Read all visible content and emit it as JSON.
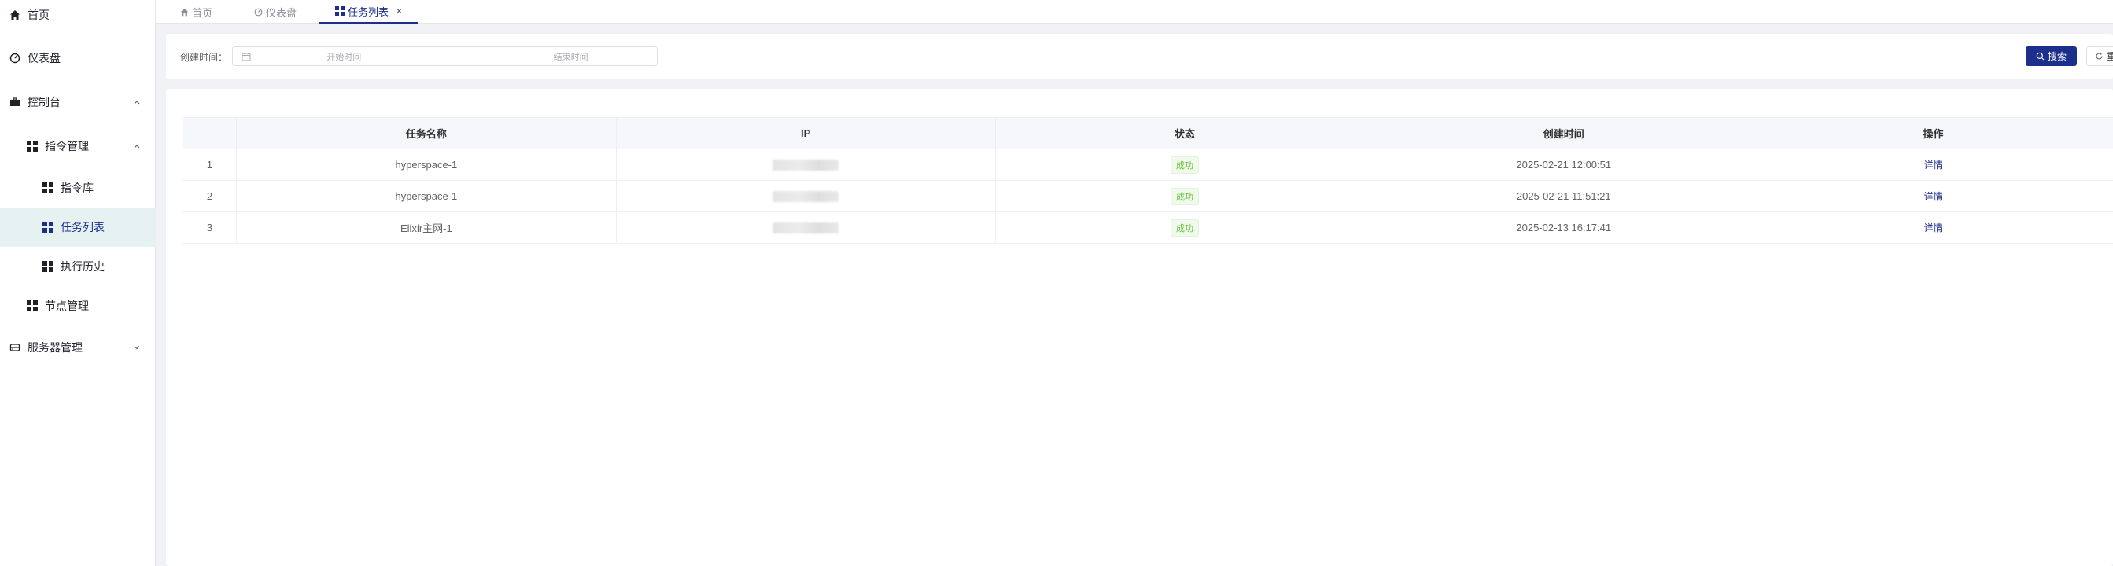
{
  "sidebar": {
    "items": [
      {
        "label": "首页",
        "icon": "home-icon"
      },
      {
        "label": "仪表盘",
        "icon": "dashboard-icon"
      },
      {
        "label": "控制台",
        "icon": "briefcase-icon",
        "expanded": true
      },
      {
        "label": "指令管理",
        "icon": "grid-icon",
        "expanded": true
      },
      {
        "label": "指令库",
        "icon": "grid-icon"
      },
      {
        "label": "任务列表",
        "icon": "grid-icon",
        "active": true
      },
      {
        "label": "执行历史",
        "icon": "grid-icon"
      },
      {
        "label": "节点管理",
        "icon": "grid-icon"
      },
      {
        "label": "服务器管理",
        "icon": "server-icon",
        "expanded": false
      }
    ]
  },
  "tabs": [
    {
      "label": "首页",
      "icon": "home-icon"
    },
    {
      "label": "仪表盘",
      "icon": "dashboard-icon"
    },
    {
      "label": "任务列表",
      "icon": "grid-icon",
      "active": true,
      "close": "×"
    }
  ],
  "filter": {
    "label": "创建时间：",
    "start_placeholder": "开始时间",
    "separator": "-",
    "end_placeholder": "结束时间",
    "search_label": "搜索",
    "reset_label": "重"
  },
  "table": {
    "columns": [
      "",
      "任务名称",
      "IP",
      "状态",
      "创建时间",
      "操作"
    ],
    "rows": [
      {
        "index": "1",
        "name": "hyperspace-1",
        "status": "成功",
        "created": "2025-02-21 12:00:51",
        "action": "详情"
      },
      {
        "index": "2",
        "name": "hyperspace-1",
        "status": "成功",
        "created": "2025-02-21 11:51:21",
        "action": "详情"
      },
      {
        "index": "3",
        "name": "Elixir主网-1",
        "status": "成功",
        "created": "2025-02-13 16:17:41",
        "action": "详情"
      }
    ]
  },
  "colors": {
    "accent": "#1d2f8c",
    "active_bg": "#e6f1f2",
    "success": "#67c23a"
  }
}
